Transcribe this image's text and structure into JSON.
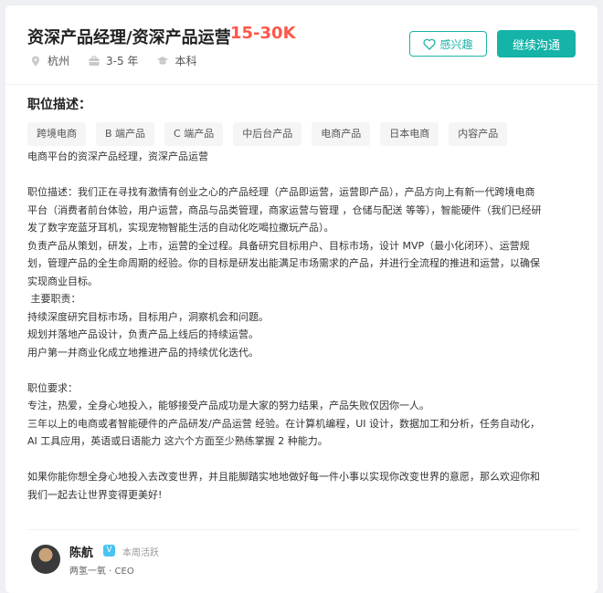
{
  "header": {
    "title": "资深产品经理/资深产品运营",
    "salary": "15-30K",
    "location": "杭州",
    "experience": "3-5 年",
    "education": "本科",
    "interest_label": "感兴趣",
    "chat_label": "继续沟通",
    "icons": {
      "location": "location-pin-icon",
      "experience": "briefcase-icon",
      "education": "graduation-cap-icon",
      "interest": "heart-icon"
    },
    "colors": {
      "accent": "#15b3a8",
      "salary": "#fe574a"
    }
  },
  "section": {
    "title": "职位描述："
  },
  "tags": [
    "跨境电商",
    "B 端产品",
    "C 端产品",
    "中后台产品",
    "电商产品",
    "日本电商",
    "内容产品"
  ],
  "description": "电商平台的资深产品经理，资深产品运营\n\n职位描述：我们正在寻找有激情有创业之心的产品经理（产品即运营，运营即产品），产品方向上有新一代跨境电商\n平台（消费者前台体验，用户运营，商品与品类管理，商家运营与管理 ，仓储与配送 等等），智能硬件（我们已经研\n发了数字宠蓝牙耳机，实现宠物智能生活的自动化吃喝拉撒玩产品）。\n负责产品从策划，研发，上市，运营的全过程。具备研究目标用户、目标市场，设计 MVP（最小化闭环）、运营规\n划，管理产品的全生命周期的经验。你的目标是研发出能满足市场需求的产品，并进行全流程的推进和运营，以确保\n实现商业目标。\n 主要职责：\n持续深度研究目标市场，目标用户，洞察机会和问题。\n规划并落地产品设计，负责产品上线后的持续运营。\n用户第一并商业化成立地推进产品的持续优化迭代。\n\n职位要求：\n专注，热爱，全身心地投入，能够接受产品成功是大家的努力结果，产品失败仅因你一人。\n三年以上的电商或者智能硬件的产品研发/产品运营 经验。在计算机编程，UI 设计，数据加工和分析，任务自动化，\nAI 工具应用，英语或日语能力 这六个方面至少熟练掌握 2 种能力。\n\n如果你能你想全身心地投入去改变世界，并且能脚踏实地地做好每一件小事以实现你改变世界的意愿，那么欢迎你和\n我们一起去让世界变得更美好!",
  "recruiter": {
    "name": "陈航",
    "badge": "V",
    "active": "本周活跃",
    "company": "两氢一氧 · CEO"
  }
}
